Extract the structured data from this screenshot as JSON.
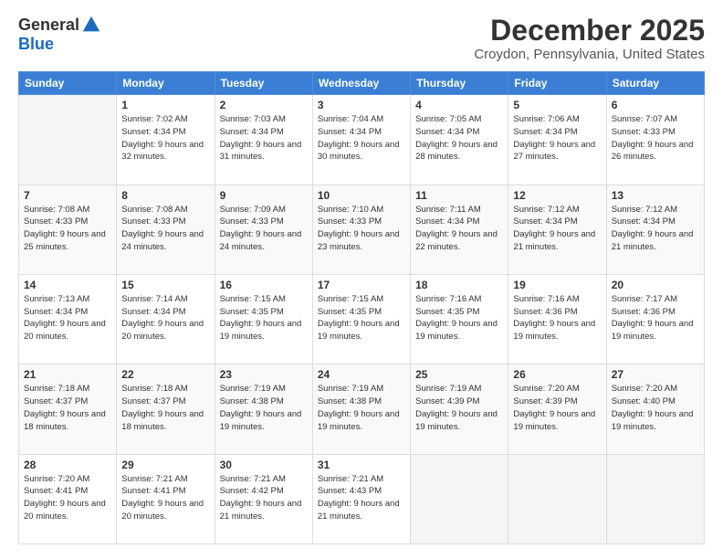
{
  "logo": {
    "general": "General",
    "blue": "Blue"
  },
  "header": {
    "month": "December 2025",
    "location": "Croydon, Pennsylvania, United States"
  },
  "days_of_week": [
    "Sunday",
    "Monday",
    "Tuesday",
    "Wednesday",
    "Thursday",
    "Friday",
    "Saturday"
  ],
  "weeks": [
    [
      {
        "day": "",
        "empty": true
      },
      {
        "day": "1",
        "sunrise": "Sunrise: 7:02 AM",
        "sunset": "Sunset: 4:34 PM",
        "daylight": "Daylight: 9 hours and 32 minutes."
      },
      {
        "day": "2",
        "sunrise": "Sunrise: 7:03 AM",
        "sunset": "Sunset: 4:34 PM",
        "daylight": "Daylight: 9 hours and 31 minutes."
      },
      {
        "day": "3",
        "sunrise": "Sunrise: 7:04 AM",
        "sunset": "Sunset: 4:34 PM",
        "daylight": "Daylight: 9 hours and 30 minutes."
      },
      {
        "day": "4",
        "sunrise": "Sunrise: 7:05 AM",
        "sunset": "Sunset: 4:34 PM",
        "daylight": "Daylight: 9 hours and 28 minutes."
      },
      {
        "day": "5",
        "sunrise": "Sunrise: 7:06 AM",
        "sunset": "Sunset: 4:34 PM",
        "daylight": "Daylight: 9 hours and 27 minutes."
      },
      {
        "day": "6",
        "sunrise": "Sunrise: 7:07 AM",
        "sunset": "Sunset: 4:33 PM",
        "daylight": "Daylight: 9 hours and 26 minutes."
      }
    ],
    [
      {
        "day": "7",
        "sunrise": "Sunrise: 7:08 AM",
        "sunset": "Sunset: 4:33 PM",
        "daylight": "Daylight: 9 hours and 25 minutes."
      },
      {
        "day": "8",
        "sunrise": "Sunrise: 7:08 AM",
        "sunset": "Sunset: 4:33 PM",
        "daylight": "Daylight: 9 hours and 24 minutes."
      },
      {
        "day": "9",
        "sunrise": "Sunrise: 7:09 AM",
        "sunset": "Sunset: 4:33 PM",
        "daylight": "Daylight: 9 hours and 24 minutes."
      },
      {
        "day": "10",
        "sunrise": "Sunrise: 7:10 AM",
        "sunset": "Sunset: 4:33 PM",
        "daylight": "Daylight: 9 hours and 23 minutes."
      },
      {
        "day": "11",
        "sunrise": "Sunrise: 7:11 AM",
        "sunset": "Sunset: 4:34 PM",
        "daylight": "Daylight: 9 hours and 22 minutes."
      },
      {
        "day": "12",
        "sunrise": "Sunrise: 7:12 AM",
        "sunset": "Sunset: 4:34 PM",
        "daylight": "Daylight: 9 hours and 21 minutes."
      },
      {
        "day": "13",
        "sunrise": "Sunrise: 7:12 AM",
        "sunset": "Sunset: 4:34 PM",
        "daylight": "Daylight: 9 hours and 21 minutes."
      }
    ],
    [
      {
        "day": "14",
        "sunrise": "Sunrise: 7:13 AM",
        "sunset": "Sunset: 4:34 PM",
        "daylight": "Daylight: 9 hours and 20 minutes."
      },
      {
        "day": "15",
        "sunrise": "Sunrise: 7:14 AM",
        "sunset": "Sunset: 4:34 PM",
        "daylight": "Daylight: 9 hours and 20 minutes."
      },
      {
        "day": "16",
        "sunrise": "Sunrise: 7:15 AM",
        "sunset": "Sunset: 4:35 PM",
        "daylight": "Daylight: 9 hours and 19 minutes."
      },
      {
        "day": "17",
        "sunrise": "Sunrise: 7:15 AM",
        "sunset": "Sunset: 4:35 PM",
        "daylight": "Daylight: 9 hours and 19 minutes."
      },
      {
        "day": "18",
        "sunrise": "Sunrise: 7:16 AM",
        "sunset": "Sunset: 4:35 PM",
        "daylight": "Daylight: 9 hours and 19 minutes."
      },
      {
        "day": "19",
        "sunrise": "Sunrise: 7:16 AM",
        "sunset": "Sunset: 4:36 PM",
        "daylight": "Daylight: 9 hours and 19 minutes."
      },
      {
        "day": "20",
        "sunrise": "Sunrise: 7:17 AM",
        "sunset": "Sunset: 4:36 PM",
        "daylight": "Daylight: 9 hours and 19 minutes."
      }
    ],
    [
      {
        "day": "21",
        "sunrise": "Sunrise: 7:18 AM",
        "sunset": "Sunset: 4:37 PM",
        "daylight": "Daylight: 9 hours and 18 minutes."
      },
      {
        "day": "22",
        "sunrise": "Sunrise: 7:18 AM",
        "sunset": "Sunset: 4:37 PM",
        "daylight": "Daylight: 9 hours and 18 minutes."
      },
      {
        "day": "23",
        "sunrise": "Sunrise: 7:19 AM",
        "sunset": "Sunset: 4:38 PM",
        "daylight": "Daylight: 9 hours and 19 minutes."
      },
      {
        "day": "24",
        "sunrise": "Sunrise: 7:19 AM",
        "sunset": "Sunset: 4:38 PM",
        "daylight": "Daylight: 9 hours and 19 minutes."
      },
      {
        "day": "25",
        "sunrise": "Sunrise: 7:19 AM",
        "sunset": "Sunset: 4:39 PM",
        "daylight": "Daylight: 9 hours and 19 minutes."
      },
      {
        "day": "26",
        "sunrise": "Sunrise: 7:20 AM",
        "sunset": "Sunset: 4:39 PM",
        "daylight": "Daylight: 9 hours and 19 minutes."
      },
      {
        "day": "27",
        "sunrise": "Sunrise: 7:20 AM",
        "sunset": "Sunset: 4:40 PM",
        "daylight": "Daylight: 9 hours and 19 minutes."
      }
    ],
    [
      {
        "day": "28",
        "sunrise": "Sunrise: 7:20 AM",
        "sunset": "Sunset: 4:41 PM",
        "daylight": "Daylight: 9 hours and 20 minutes."
      },
      {
        "day": "29",
        "sunrise": "Sunrise: 7:21 AM",
        "sunset": "Sunset: 4:41 PM",
        "daylight": "Daylight: 9 hours and 20 minutes."
      },
      {
        "day": "30",
        "sunrise": "Sunrise: 7:21 AM",
        "sunset": "Sunset: 4:42 PM",
        "daylight": "Daylight: 9 hours and 21 minutes."
      },
      {
        "day": "31",
        "sunrise": "Sunrise: 7:21 AM",
        "sunset": "Sunset: 4:43 PM",
        "daylight": "Daylight: 9 hours and 21 minutes."
      },
      {
        "day": "",
        "empty": true
      },
      {
        "day": "",
        "empty": true
      },
      {
        "day": "",
        "empty": true
      }
    ]
  ]
}
